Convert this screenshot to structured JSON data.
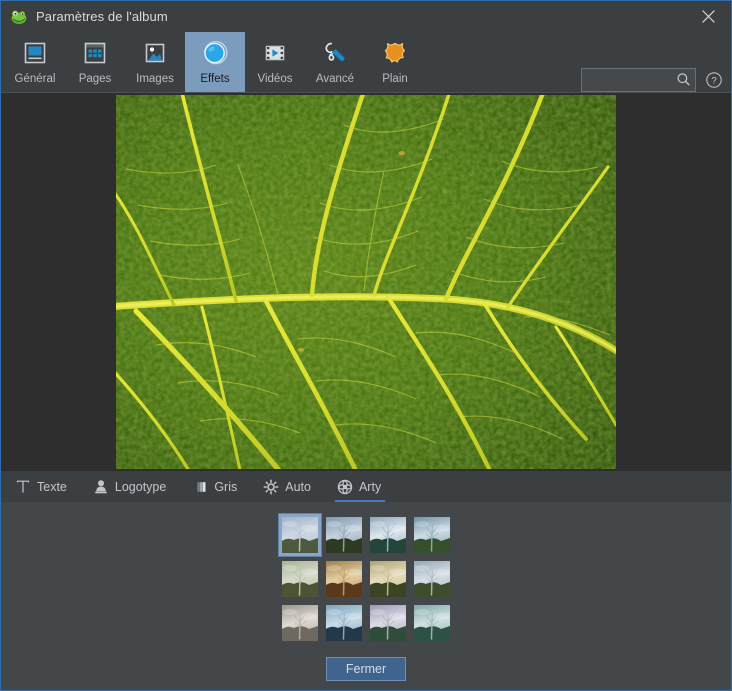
{
  "window": {
    "title": "Paramètres de l'album",
    "app_icon": "frog-icon",
    "close_icon": "close-icon",
    "accent_color": "#2f6fb0",
    "titlebar_color": "#3b3f42"
  },
  "toolbar": {
    "items": [
      {
        "label": "Général",
        "icon": "general-icon",
        "selected": false
      },
      {
        "label": "Pages",
        "icon": "pages-icon",
        "selected": false
      },
      {
        "label": "Images",
        "icon": "images-icon",
        "selected": false
      },
      {
        "label": "Effets",
        "icon": "effects-icon",
        "selected": true
      },
      {
        "label": "Vidéos",
        "icon": "videos-icon",
        "selected": false
      },
      {
        "label": "Avancé",
        "icon": "advanced-wrench-icon",
        "selected": false
      },
      {
        "label": "Plain",
        "icon": "plain-star-icon",
        "selected": false
      }
    ],
    "search": {
      "value": "",
      "placeholder": "",
      "icon": "search-icon"
    },
    "help": {
      "icon": "help-icon",
      "label": "?"
    },
    "selected_color": "#7c9cbe"
  },
  "preview": {
    "image_alt": "green-leaf-macro",
    "background_color": "#2e2e2e"
  },
  "effect_tabs": {
    "items": [
      {
        "label": "Texte",
        "icon": "text-icon",
        "active": false
      },
      {
        "label": "Logotype",
        "icon": "stamp-icon",
        "active": false
      },
      {
        "label": "Gris",
        "icon": "grayscale-bars-icon",
        "active": false
      },
      {
        "label": "Auto",
        "icon": "auto-gear-icon",
        "active": false
      },
      {
        "label": "Arty",
        "icon": "flower-icon",
        "active": true
      }
    ],
    "underline_color": "#4a7db5"
  },
  "thumbnails": {
    "alt": "tree-preset-thumbnail",
    "selected_index": 0,
    "items": [
      {
        "name": "preset-1",
        "sky_top": "#9fb4c9",
        "sky_bottom": "#cfd9e2",
        "ground": "#4e5a3e",
        "tone": "#b9c6d4"
      },
      {
        "name": "preset-2",
        "sky_top": "#7e99b4",
        "sky_bottom": "#c6d2dc",
        "ground": "#2f3a22",
        "tone": "#93a9bd"
      },
      {
        "name": "preset-3",
        "sky_top": "#8fa7bd",
        "sky_bottom": "#dfe7ee",
        "ground": "#24463a",
        "tone": "#a3b8c9"
      },
      {
        "name": "preset-4",
        "sky_top": "#6f93a8",
        "sky_bottom": "#cfdbe2",
        "ground": "#36502c",
        "tone": "#8fb0c0"
      },
      {
        "name": "preset-5",
        "sky_top": "#a9b398",
        "sky_bottom": "#d4dbc9",
        "ground": "#4c5436",
        "tone": "#bcc4ab"
      },
      {
        "name": "preset-6",
        "sky_top": "#9f7e44",
        "sky_bottom": "#e4cfa5",
        "ground": "#5b3a1b",
        "tone": "#c4a06a"
      },
      {
        "name": "preset-7",
        "sky_top": "#b0a272",
        "sky_bottom": "#e6ddbd",
        "ground": "#3b4424",
        "tone": "#cbc093"
      },
      {
        "name": "preset-8",
        "sky_top": "#93a8b8",
        "sky_bottom": "#d7dfe4",
        "ground": "#3d4e2c",
        "tone": "#adbdc8"
      },
      {
        "name": "preset-9",
        "sky_top": "#9b968e",
        "sky_bottom": "#ded9d2",
        "ground": "#6e6a62",
        "tone": "#b9b4ac"
      },
      {
        "name": "preset-10",
        "sky_top": "#7da4bd",
        "sky_bottom": "#c8dbe6",
        "ground": "#24384a",
        "tone": "#92b4c9"
      },
      {
        "name": "preset-11",
        "sky_top": "#9a9ab4",
        "sky_bottom": "#dcdce6",
        "ground": "#2f4d3a",
        "tone": "#b1b1c4"
      },
      {
        "name": "preset-12",
        "sky_top": "#7fa8a8",
        "sky_bottom": "#d2e0e0",
        "ground": "#2e5046",
        "tone": "#9cbcbc"
      }
    ]
  },
  "footer": {
    "close_label": "Fermer",
    "button_color": "#3f658e"
  }
}
